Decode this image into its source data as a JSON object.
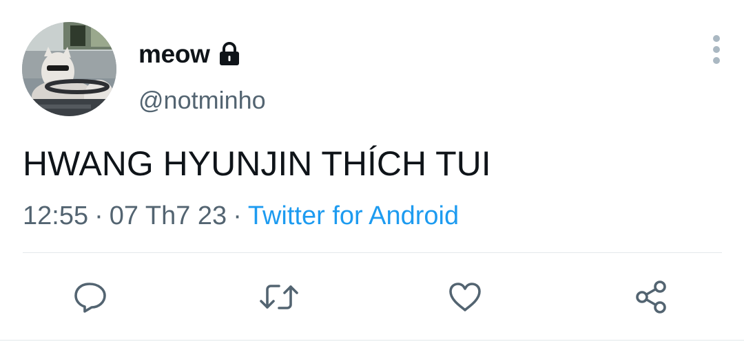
{
  "tweet": {
    "author": {
      "display_name": "meow",
      "handle": "@notminho",
      "protected_icon": "lock-icon",
      "avatar": "cat-driving-avatar"
    },
    "text": "HWANG HYUNJIN THÍCH TUI",
    "meta": {
      "time": "12:55",
      "separator": "·",
      "date": "07 Th7 23",
      "source": "Twitter for Android"
    },
    "more_icon": "more-vertical-icon",
    "actions": [
      {
        "icon": "reply-icon"
      },
      {
        "icon": "retweet-icon"
      },
      {
        "icon": "like-icon"
      },
      {
        "icon": "share-icon"
      }
    ],
    "colors": {
      "text": "#0f1419",
      "secondary": "#536471",
      "link": "#1d9bf0",
      "icon": "#536471",
      "divider": "#e4e8eb"
    }
  }
}
